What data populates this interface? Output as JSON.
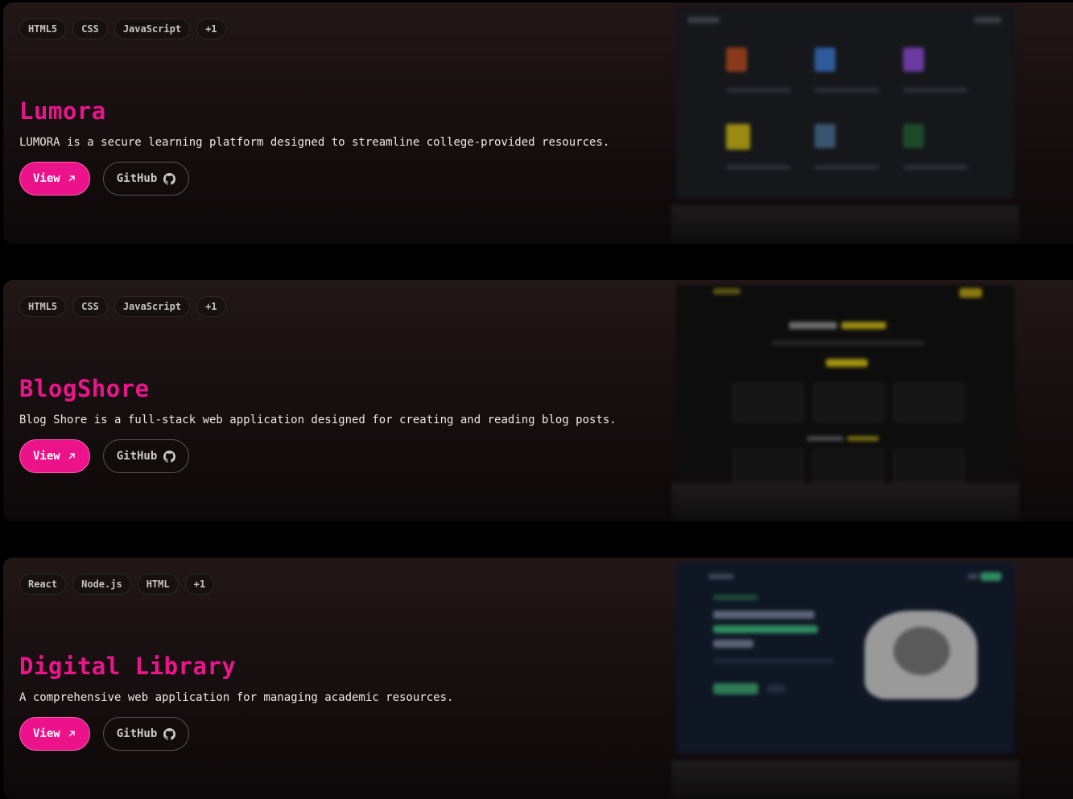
{
  "projects": [
    {
      "tags": [
        "HTML5",
        "CSS",
        "JavaScript",
        "+1"
      ],
      "title": "Lumora",
      "description": "LUMORA is a secure learning platform designed to streamline college-provided resources.",
      "view_label": "View",
      "github_label": "GitHub",
      "preview_theme": "dark-dashboard"
    },
    {
      "tags": [
        "HTML5",
        "CSS",
        "JavaScript",
        "+1"
      ],
      "title": "BlogShore",
      "description": "Blog Shore is a full-stack web application designed for creating and reading blog posts.",
      "view_label": "View",
      "github_label": "GitHub",
      "preview_theme": "dark-yellow"
    },
    {
      "tags": [
        "React",
        "Node.js",
        "HTML",
        "+1"
      ],
      "title": "Digital Library",
      "description": "A comprehensive web application for managing academic resources.",
      "view_label": "View",
      "github_label": "GitHub",
      "preview_theme": "navy-green"
    }
  ],
  "colors": {
    "accent": "#ec1289",
    "title": "#e8168a",
    "background": "#000000",
    "card": "#1c1213"
  },
  "icons": {
    "view": "arrow-up-right-icon",
    "github": "github-icon"
  }
}
